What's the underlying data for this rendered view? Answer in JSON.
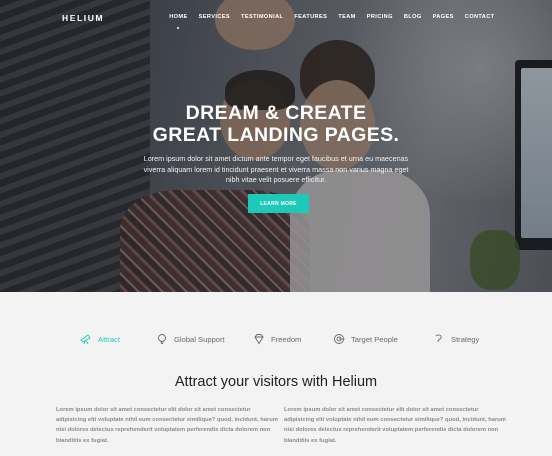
{
  "nav": {
    "logo": "HELIUM",
    "items": [
      "HOME",
      "SERVICES",
      "TESTIMONIAL",
      "FEATURES",
      "TEAM",
      "PRICING",
      "BLOG",
      "PAGES",
      "CONTACT"
    ]
  },
  "hero": {
    "title_line1": "DREAM & CREATE",
    "title_line2": "GREAT LANDING PAGES.",
    "text": "Lorem ipsum dolor sit amet dictum ante tempor eget faucibus et urna eu maecenas viverra aliquam lorem id tincidunt praesent et viverra massa non varius magna eget nibh vitae velit posuere efficitur.",
    "button": "LEARN MORE"
  },
  "tabs": [
    {
      "label": "Attract",
      "icon": "telescope-icon"
    },
    {
      "label": "Global Support",
      "icon": "lightbulb-icon"
    },
    {
      "label": "Freedom",
      "icon": "diamond-icon"
    },
    {
      "label": "Target People",
      "icon": "target-icon"
    },
    {
      "label": "Strategy",
      "icon": "strategy-icon"
    }
  ],
  "section": {
    "title": "Attract your visitors with Helium",
    "col1": "Lorem ipsum dolor sit amet consectetur elit dolor sit amet consectetur adipisicing elit voluptate nihil eum consectetur similique? quod, incidunt, harum nisi dolores delectus reprehenderit voluptatem perferendis dicta dolorem non blanditiis ex fugiat.",
    "col2": "Lorem ipsum dolor sit amet consectetur elit dolor sit amet consectetur adipisicing elit voluptate nihil eum consectetur similique? quod, incidunt, harum nisi dolores delectus reprehenderit voluptatem perferendis dicta dolorem non blanditiis ex fugiat."
  },
  "colors": {
    "accent": "#1fc9b7",
    "text": "#222222",
    "muted": "#8a8a8a"
  }
}
